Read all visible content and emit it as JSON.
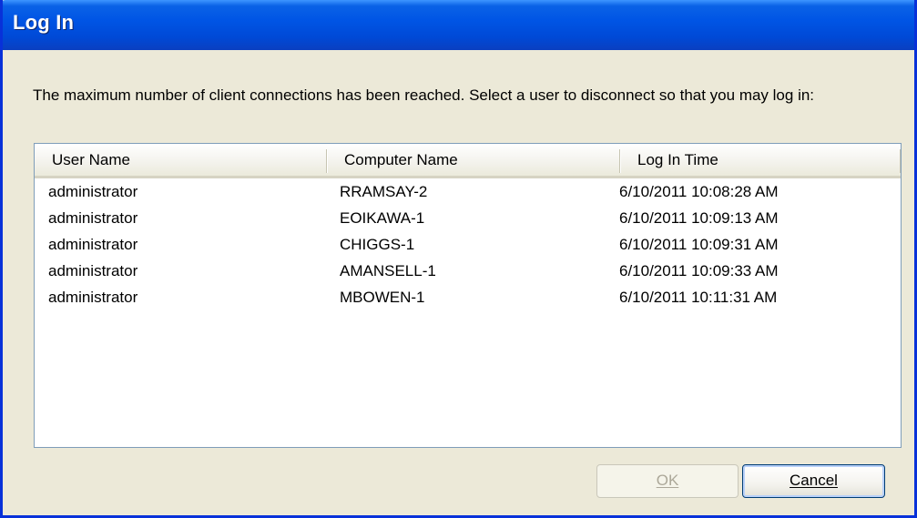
{
  "window": {
    "title": "Log In"
  },
  "message": "The maximum number of client connections has been reached. Select a user to disconnect so that you may log in:",
  "list": {
    "columns": [
      "User Name",
      "Computer Name",
      "Log In Time"
    ],
    "rows": [
      {
        "user": "administrator",
        "computer": "RRAMSAY-2",
        "time": "6/10/2011 10:08:28 AM"
      },
      {
        "user": "administrator",
        "computer": "EOIKAWA-1",
        "time": "6/10/2011 10:09:13 AM"
      },
      {
        "user": "administrator",
        "computer": "CHIGGS-1",
        "time": "6/10/2011 10:09:31 AM"
      },
      {
        "user": "administrator",
        "computer": "AMANSELL-1",
        "time": "6/10/2011 10:09:33 AM"
      },
      {
        "user": "administrator",
        "computer": "MBOWEN-1",
        "time": "6/10/2011 10:11:31 AM"
      }
    ]
  },
  "buttons": {
    "ok_label": "OK",
    "ok_enabled": false,
    "cancel_label": "Cancel"
  },
  "colors": {
    "titlebar": "#0055e5",
    "dialog_background": "#ece9d8",
    "list_border": "#7f9db9"
  }
}
